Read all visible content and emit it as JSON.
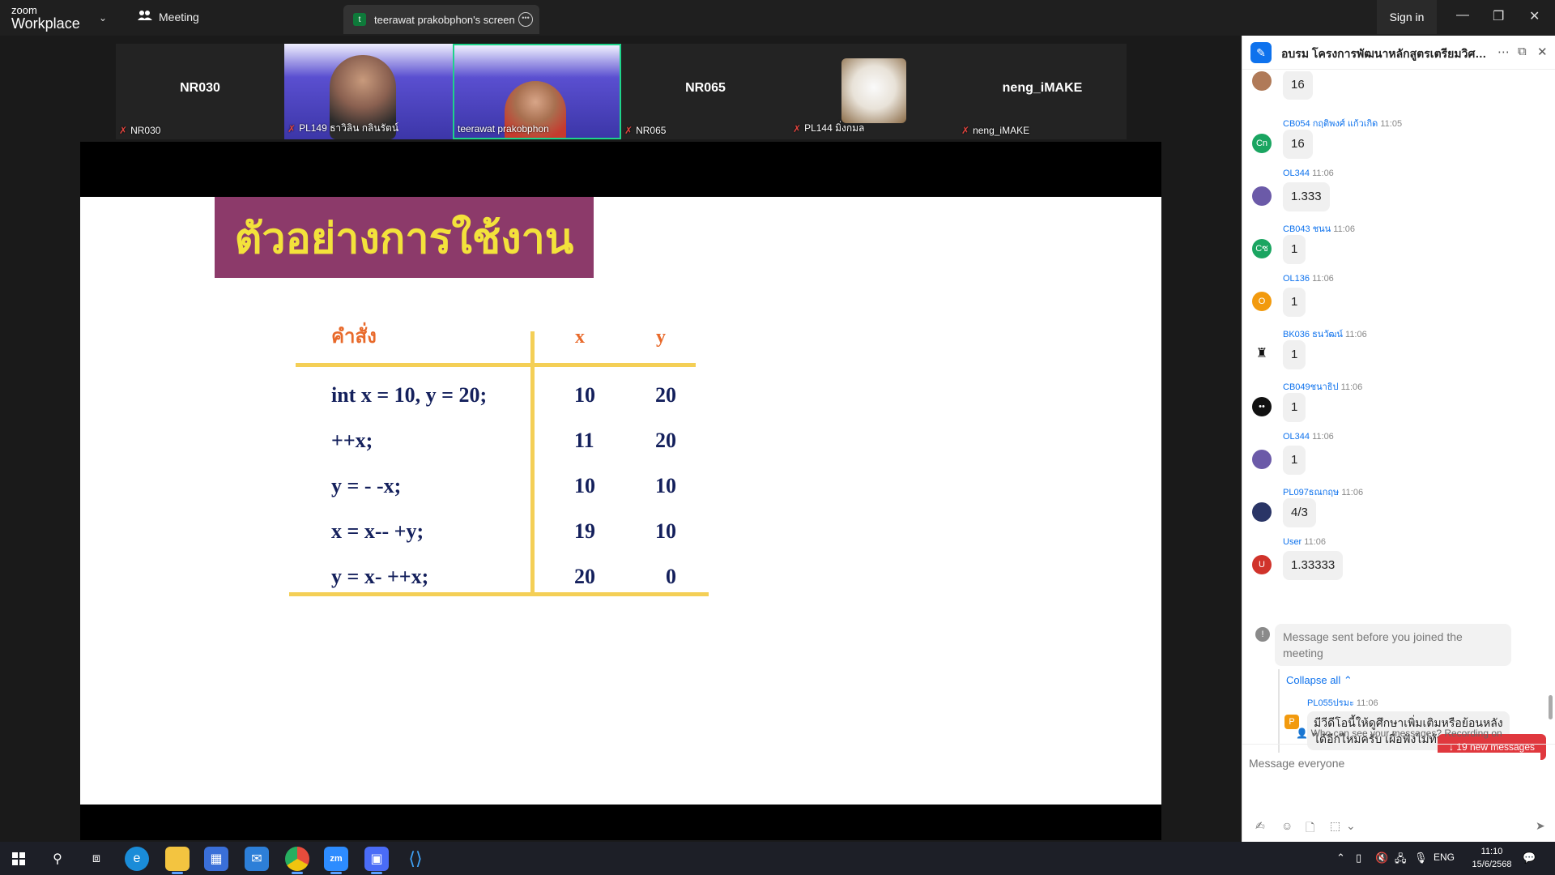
{
  "titlebar": {
    "logo_line1": "zoom",
    "logo_line2": "Workplace",
    "meeting_label": "Meeting",
    "screen_tab_badge": "t",
    "screen_tab_label": "teerawat prakobphon's screen",
    "signin_label": "Sign in"
  },
  "participants": [
    {
      "big_name": "NR030",
      "label": "NR030",
      "kind": "name"
    },
    {
      "big_name": "",
      "label": "PL149 ธาวิลิน กลินรัตน์",
      "kind": "video"
    },
    {
      "big_name": "",
      "label": "teerawat prakobphon",
      "kind": "video-active"
    },
    {
      "big_name": "NR065",
      "label": "NR065",
      "kind": "name"
    },
    {
      "big_name": "",
      "label": "PL144 มิ่งกมล",
      "kind": "photo"
    },
    {
      "big_name": "neng_iMAKE",
      "label": "neng_iMAKE",
      "kind": "name"
    }
  ],
  "slide": {
    "title": "ตัวอย่างการใช้งาน",
    "headers": {
      "command": "คำสั่ง",
      "x": "x",
      "y": "y"
    },
    "rows": [
      {
        "cmd": "int x = 10, y = 20;",
        "x": "10",
        "y": "20"
      },
      {
        "cmd": "++x;",
        "x": "11",
        "y": "20"
      },
      {
        "cmd": "y = - -x;",
        "x": "10",
        "y": "10"
      },
      {
        "cmd": "x = x-- +y;",
        "x": "19",
        "y": "10"
      },
      {
        "cmd": "y = x- ++x;",
        "x": "20",
        "y": "0"
      }
    ]
  },
  "chat": {
    "title": "อบรม โครงการพัฒนาหลักสูตรเตรียมวิศวก...",
    "messages": [
      {
        "name": "",
        "time": "",
        "text": "16",
        "avatar": "",
        "avatar_color": "#b07a58"
      },
      {
        "name": "CB054 กฤติพงศ์ แก้วเกิด",
        "time": "11:05",
        "text": "16",
        "avatar": "Cn",
        "avatar_color": "#1aa561"
      },
      {
        "name": "OL344",
        "time": "11:06",
        "text": "1.333",
        "avatar": "",
        "avatar_color": "#6b5aa8"
      },
      {
        "name": "CB043 ชนน",
        "time": "11:06",
        "text": "1",
        "avatar": "Cซ",
        "avatar_color": "#1aa561"
      },
      {
        "name": "OL136",
        "time": "11:06",
        "text": "1",
        "avatar": "O",
        "avatar_color": "#f29a0e"
      },
      {
        "name": "BK036 ธนวัฒน์",
        "time": "11:06",
        "text": "1",
        "avatar": "",
        "avatar_color": "#1a1a1a"
      },
      {
        "name": "CB049ชนาธิป",
        "time": "11:06",
        "text": "1",
        "avatar": "",
        "avatar_color": "#111111"
      },
      {
        "name": "OL344",
        "time": "11:06",
        "text": "1",
        "avatar": "",
        "avatar_color": "#6b5aa8"
      },
      {
        "name": "PL097ธณกฤษ",
        "time": "11:06",
        "text": "4/3",
        "avatar": "",
        "avatar_color": "#2a3566"
      },
      {
        "name": "User",
        "time": "11:06",
        "text": "1.33333",
        "avatar": "U",
        "avatar_color": "#d0332b"
      }
    ],
    "system_note": "Message sent before you joined the meeting",
    "collapse_label": "Collapse all",
    "reply": {
      "avatar": "P",
      "name": "PL055ปรมะ",
      "time": "11:06",
      "text": "มีวีดีโอนี้ให้ดูศึกษาเพิ่มเติมหรือย้อนหลังได้อีกไหมครับ เผื่อฟังไม่ทันบาง"
    },
    "new_messages": "19 new messages",
    "who_can_see": "Who can see your messages? Recording on",
    "input_placeholder": "Message everyone"
  },
  "taskbar": {
    "language": "ENG",
    "time": "11:10",
    "date": "15/6/2568"
  }
}
